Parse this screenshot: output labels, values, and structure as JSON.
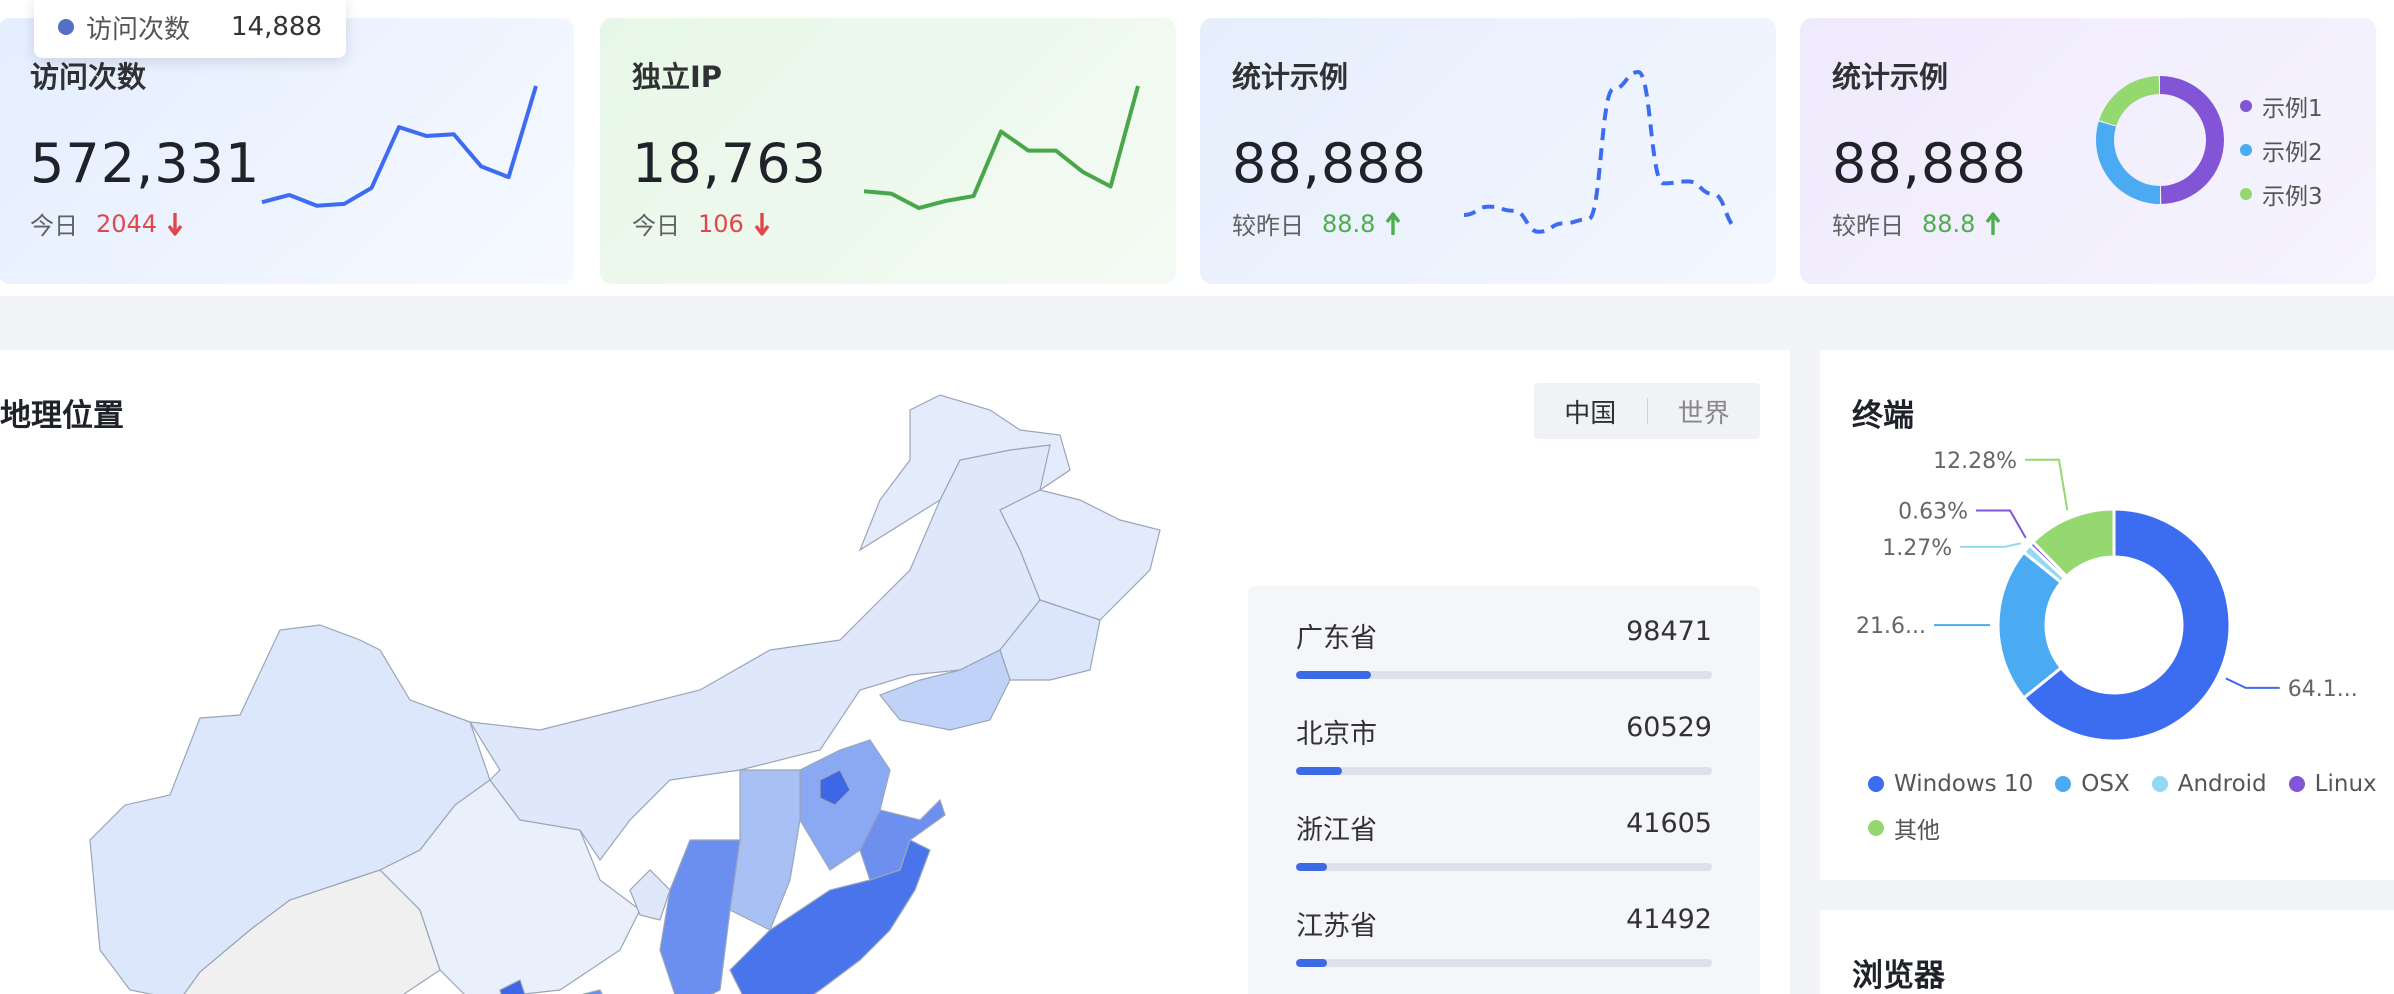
{
  "tooltip": {
    "label": "访问次数",
    "value": "14,888",
    "color": "#5470c6"
  },
  "stat_cards": [
    {
      "title": "访问次数",
      "value": "572,331",
      "foot_label": "今日",
      "foot_value": "2044",
      "trend": "down",
      "spark_color": "#3d6cf0",
      "spark": [
        10,
        14,
        8,
        9,
        18,
        52,
        47,
        48,
        30,
        24,
        75
      ]
    },
    {
      "title": "独立IP",
      "value": "18,763",
      "foot_label": "今日",
      "foot_value": "106",
      "trend": "down",
      "spark_color": "#4aa64a",
      "spark": [
        12,
        11,
        5,
        8,
        10,
        37,
        29,
        29,
        20,
        14,
        56
      ]
    },
    {
      "title": "统计示例",
      "value": "88,888",
      "foot_label": "较昨日",
      "foot_value": "88.8",
      "trend": "up",
      "spark_color": "#3d6cf0",
      "spark_dashed": true,
      "spark": [
        10,
        14,
        12,
        2,
        6,
        8,
        70,
        78,
        25,
        26,
        20,
        4
      ]
    },
    {
      "title": "统计示例",
      "value": "88,888",
      "foot_label": "较昨日",
      "foot_value": "88.8",
      "trend": "up",
      "donut": [
        {
          "name": "示例1",
          "value": 50,
          "color": "#8155d6"
        },
        {
          "name": "示例2",
          "value": 30,
          "color": "#4aaaf2"
        },
        {
          "name": "示例3",
          "value": 20,
          "color": "#95d86f"
        }
      ]
    }
  ],
  "geo": {
    "title": "地理位置",
    "toggle": {
      "china": "中国",
      "world": "世界",
      "active": "china"
    },
    "ranking": [
      {
        "name": "广东省",
        "value": "98471",
        "fraction": 0.18
      },
      {
        "name": "北京市",
        "value": "60529",
        "fraction": 0.11
      },
      {
        "name": "浙江省",
        "value": "41605",
        "fraction": 0.075
      },
      {
        "name": "江苏省",
        "value": "41492",
        "fraction": 0.075
      }
    ]
  },
  "terminal": {
    "title": "终端",
    "chart_data": {
      "type": "pie",
      "series": [
        {
          "name": "Windows 10",
          "value": 64.1,
          "label": "64.1...",
          "color": "#3c6cf0"
        },
        {
          "name": "OSX",
          "value": 21.6,
          "label": "21.6...",
          "color": "#4aaaf2"
        },
        {
          "name": "Android",
          "value": 1.27,
          "label": "1.27%",
          "color": "#93d8f5"
        },
        {
          "name": "Linux",
          "value": 0.63,
          "label": "0.63%",
          "color": "#8155d6"
        },
        {
          "name": "其他",
          "value": 12.28,
          "label": "12.28%",
          "color": "#95d86f"
        }
      ]
    }
  },
  "browser": {
    "title": "浏览器"
  }
}
